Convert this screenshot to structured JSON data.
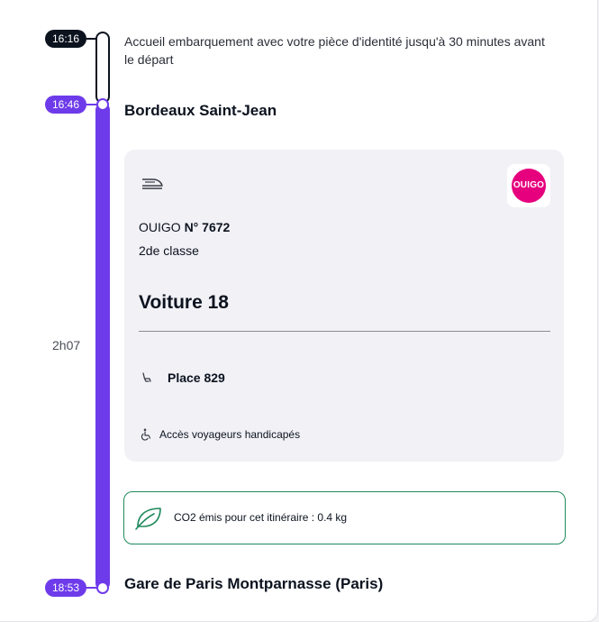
{
  "timeline": {
    "boarding_time": "16:16",
    "departure_time": "16:46",
    "arrival_time": "18:53",
    "duration": "2h07",
    "colors": {
      "accent": "#6e3bea",
      "dark": "#0c131f"
    }
  },
  "boarding_note": "Accueil embarquement avec votre pièce d'identité jusqu'à 30 minutes avant le départ",
  "departure_station": "Bordeaux Saint-Jean",
  "arrival_station": "Gare de Paris Montparnasse (Paris)",
  "train": {
    "icon": "train-icon",
    "operator": "OUIGO",
    "number_label": "N° 7672",
    "class": "2de classe",
    "logo_text": "OUIGO",
    "logo_color": "#e6007e",
    "coach": "Voiture 18",
    "seat_icon": "seat-icon",
    "seat": "Place 829",
    "accessibility_icon": "wheelchair-icon",
    "accessibility": "Accès voyageurs handicapés"
  },
  "co2": {
    "icon": "leaf-icon",
    "text": "CO2 émis pour cet itinéraire : 0.4 kg",
    "color": "#1f8a5c"
  }
}
